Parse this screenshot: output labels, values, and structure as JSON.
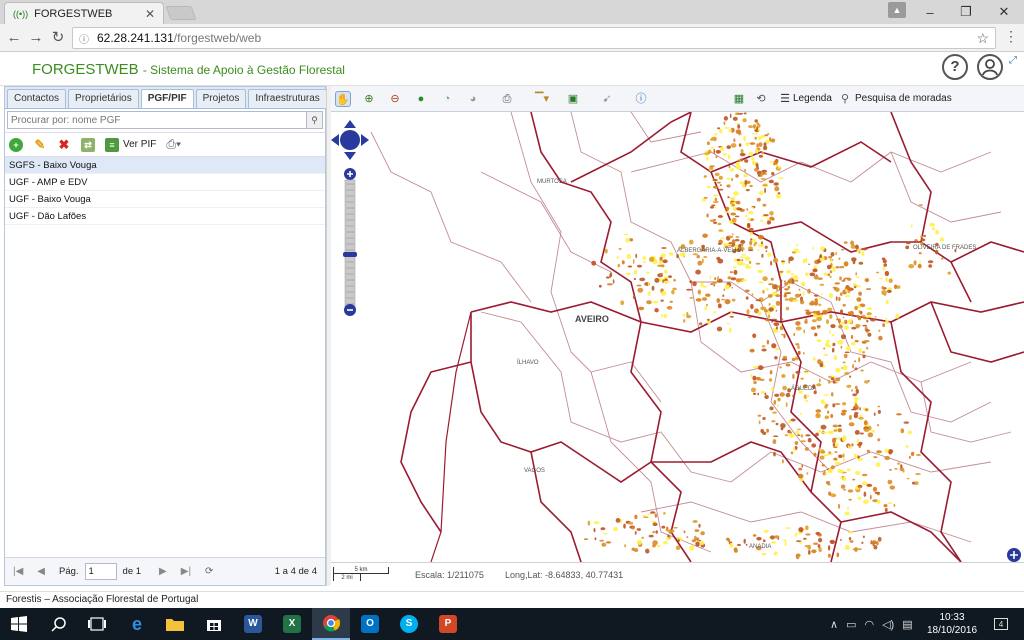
{
  "browser": {
    "tab_title": "FORGESTWEB",
    "url_host": "62.28.241.131",
    "url_path": "/forgestweb/web"
  },
  "app": {
    "title": "FORGESTWEB",
    "subtitle": "- Sistema de Apoio à Gestão Florestal"
  },
  "left_panel": {
    "tabs": [
      {
        "label": "Contactos"
      },
      {
        "label": "Proprietários"
      },
      {
        "label": "PGF/PIF"
      },
      {
        "label": "Projetos"
      },
      {
        "label": "Infraestruturas"
      }
    ],
    "search_placeholder": "Procurar por: nome PGF",
    "toolbar": {
      "ver_pif_label": "Ver PIF"
    },
    "rows": [
      {
        "label": "SGFS - Baixo Vouga"
      },
      {
        "label": "UGF - AMP e EDV"
      },
      {
        "label": "UGF - Baixo Vouga"
      },
      {
        "label": "UGF - Dão Lafões"
      }
    ],
    "pager": {
      "page_label": "Pág.",
      "page_value": "1",
      "of_label": "de 1",
      "range_label": "1 a 4 de 4"
    }
  },
  "map_toolbar": {
    "legend_label": "Legenda",
    "search_label": "Pesquisa de moradas"
  },
  "map": {
    "places": [
      {
        "name": "MURTOSA"
      },
      {
        "name": "OLIVEIRA DE FRADES"
      },
      {
        "name": "AVEIRO"
      },
      {
        "name": "ÍLHAVO"
      },
      {
        "name": "VAGOS"
      },
      {
        "name": "ANADIA"
      },
      {
        "name": "ALBERGARIA-A-VELHA"
      },
      {
        "name": "ÁGUEDA"
      }
    ]
  },
  "map_status": {
    "scale_km": "5 km",
    "scale_mi": "2 mi",
    "scale_text": "Escala: 1/211075",
    "coords_text": "Long,Lat: -8.64833, 40.77431"
  },
  "footer": "Forestis – Associação Florestal de Portugal",
  "taskbar": {
    "time": "10:33",
    "date": "18/10/2016",
    "notification_count": "4"
  },
  "colors": {
    "brand_green": "#3c8c1e",
    "map_border": "#9b1b30",
    "map_thin": "#b5707c",
    "patch_orange": "#d97a1c",
    "patch_yellow": "#fff24a"
  }
}
